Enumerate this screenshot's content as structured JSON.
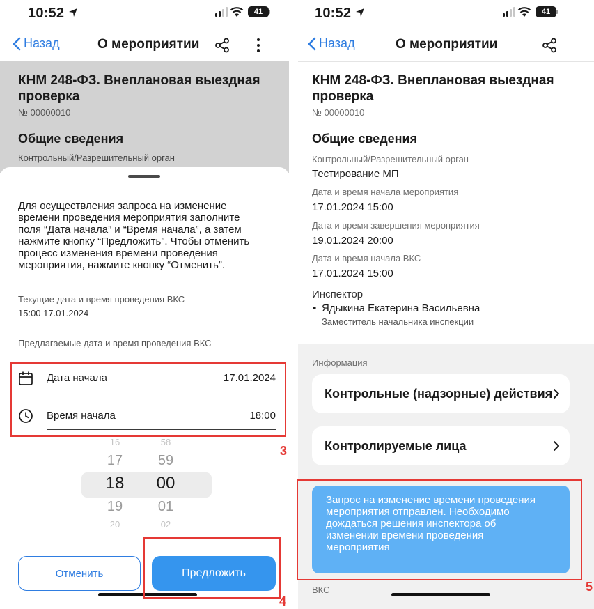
{
  "status_bar": {
    "time": "10:52",
    "battery": "41"
  },
  "left": {
    "nav": {
      "back": "Назад",
      "title": "О мероприятии"
    },
    "event_title": "КНМ 248-ФЗ. Внеплановая выездная проверка",
    "event_number": "№ 00000010",
    "general_section": "Общие сведения",
    "authority_label": "Контрольный/Разрешительный орган",
    "sheet": {
      "description": [
        "Для осуществления запроса на изменение",
        "времени проведения мероприятия заполните",
        "поля “Дата начала” и “Время начала”, а затем",
        "нажмите кнопку “Предложить”. Чтобы отменить",
        "процесс изменения времени проведения",
        "мероприятия, нажмите кнопку “Отменить”."
      ],
      "current_label": "Текущие дата и время проведения ВКС",
      "current_value": "15:00 17.01.2024",
      "proposed_label": "Предлагаемые дата и время проведения ВКС",
      "date_field": {
        "label": "Дата начала",
        "value": "17.01.2024"
      },
      "time_field": {
        "label": "Время начала",
        "value": "18:00"
      },
      "picker": {
        "hours": [
          "16",
          "17",
          "18",
          "19",
          "20"
        ],
        "minutes": [
          "58",
          "59",
          "00",
          "01",
          "02"
        ]
      },
      "cancel_button": "Отменить",
      "propose_button": "Предложить"
    }
  },
  "right": {
    "nav": {
      "back": "Назад",
      "title": "О мероприятии"
    },
    "event_title": "КНМ 248-ФЗ. Внеплановая выездная проверка",
    "event_number": "№ 00000010",
    "general_section": "Общие сведения",
    "fields": [
      {
        "label": "Контрольный/Разрешительный орган",
        "value": "Тестирование МП"
      },
      {
        "label": "Дата и время начала мероприятия",
        "value": "17.01.2024 15:00"
      },
      {
        "label": "Дата и время завершения мероприятия",
        "value": "19.01.2024 20:00"
      },
      {
        "label": "Дата и время начала ВКС",
        "value": "17.01.2024 15:00"
      }
    ],
    "inspector_label": "Инспектор",
    "inspector_name": "Ядыкина Екатерина Васильевна",
    "inspector_role": "Заместитель начальника инспекции",
    "info_label": "Информация",
    "card1": "Контрольные (надзорные) действия",
    "card2": "Контролируемые лица",
    "toast": [
      "Запрос на изменение времени проведения",
      "мероприятия отправлен. Необходимо",
      "дождаться решения инспектора об",
      "изменении времени проведения",
      "мероприятия"
    ],
    "vks_label": "ВКС"
  },
  "annotations": {
    "n3": "3",
    "n4": "4",
    "n5": "5"
  },
  "colors": {
    "accent": "#2f7de1",
    "button": "#3595ee",
    "toast": "#5fb1f5",
    "annotation": "#e53935"
  }
}
